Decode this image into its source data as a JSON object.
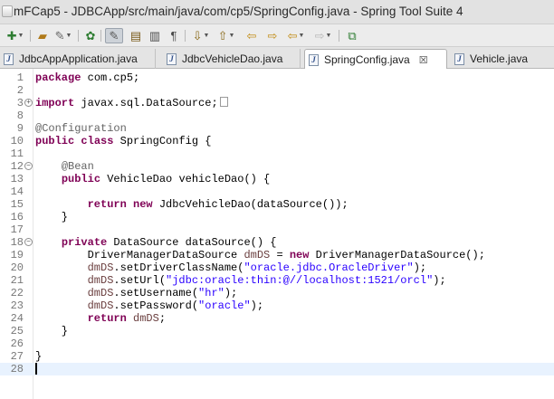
{
  "window": {
    "title": "mFCap5 - JDBCApp/src/main/java/com/cp5/SpringConfig.java - Spring Tool Suite 4"
  },
  "toolbar": {
    "icons": [
      "new-wizard-icon",
      "open-type-icon",
      "build-icon",
      "debug-icon",
      "edit-icon",
      "highlight-icon",
      "open-declaration-icon",
      "toggle-view-icon",
      "show-whitespace-icon",
      "next-annotation-icon",
      "prev-annotation-icon",
      "last-edit-icon",
      "back-icon",
      "forward-icon",
      "open-perspective-icon"
    ]
  },
  "tabs": [
    {
      "label": "JdbcAppApplication.java",
      "active": false
    },
    {
      "label": "JdbcVehicleDao.java",
      "active": false
    },
    {
      "label": "SpringConfig.java",
      "active": true,
      "close": "☒"
    },
    {
      "label": "Vehicle.java",
      "active": false
    }
  ],
  "editor": {
    "lines": [
      {
        "n": "1",
        "fold": "",
        "tokens": [
          {
            "t": "package",
            "c": "kw"
          },
          {
            "t": " com.cp5;",
            "c": ""
          }
        ]
      },
      {
        "n": "2",
        "fold": "",
        "tokens": []
      },
      {
        "n": "3",
        "fold": "+",
        "tokens": [
          {
            "t": "import",
            "c": "kw"
          },
          {
            "t": " javax.sql.DataSource;",
            "c": ""
          }
        ],
        "ellipsis": true
      },
      {
        "n": "8",
        "fold": "",
        "tokens": []
      },
      {
        "n": "9",
        "fold": "",
        "tokens": [
          {
            "t": "@Configuration",
            "c": "an"
          }
        ]
      },
      {
        "n": "10",
        "fold": "",
        "tokens": [
          {
            "t": "public",
            "c": "kw"
          },
          {
            "t": " ",
            "c": ""
          },
          {
            "t": "class",
            "c": "kw"
          },
          {
            "t": " SpringConfig {",
            "c": ""
          }
        ]
      },
      {
        "n": "11",
        "fold": "",
        "tokens": []
      },
      {
        "n": "12",
        "fold": "−",
        "tokens": [
          {
            "t": "    ",
            "c": ""
          },
          {
            "t": "@Bean",
            "c": "an"
          }
        ]
      },
      {
        "n": "13",
        "fold": "",
        "tokens": [
          {
            "t": "    ",
            "c": ""
          },
          {
            "t": "public",
            "c": "kw"
          },
          {
            "t": " VehicleDao vehicleDao() {",
            "c": ""
          }
        ]
      },
      {
        "n": "14",
        "fold": "",
        "tokens": []
      },
      {
        "n": "15",
        "fold": "",
        "tokens": [
          {
            "t": "        ",
            "c": ""
          },
          {
            "t": "return",
            "c": "kw"
          },
          {
            "t": " ",
            "c": ""
          },
          {
            "t": "new",
            "c": "kw"
          },
          {
            "t": " JdbcVehicleDao(dataSource());",
            "c": ""
          }
        ]
      },
      {
        "n": "16",
        "fold": "",
        "tokens": [
          {
            "t": "    }",
            "c": ""
          }
        ]
      },
      {
        "n": "17",
        "fold": "",
        "tokens": []
      },
      {
        "n": "18",
        "fold": "−",
        "tokens": [
          {
            "t": "    ",
            "c": ""
          },
          {
            "t": "private",
            "c": "kw"
          },
          {
            "t": " DataSource dataSource() {",
            "c": ""
          }
        ]
      },
      {
        "n": "19",
        "fold": "",
        "tokens": [
          {
            "t": "        DriverManagerDataSource ",
            "c": ""
          },
          {
            "t": "dmDS",
            "c": "fld"
          },
          {
            "t": " = ",
            "c": ""
          },
          {
            "t": "new",
            "c": "kw"
          },
          {
            "t": " DriverManagerDataSource();",
            "c": ""
          }
        ]
      },
      {
        "n": "20",
        "fold": "",
        "tokens": [
          {
            "t": "        ",
            "c": ""
          },
          {
            "t": "dmDS",
            "c": "fld"
          },
          {
            "t": ".setDriverClassName(",
            "c": ""
          },
          {
            "t": "\"oracle.jdbc.OracleDriver\"",
            "c": "str"
          },
          {
            "t": ");",
            "c": ""
          }
        ]
      },
      {
        "n": "21",
        "fold": "",
        "tokens": [
          {
            "t": "        ",
            "c": ""
          },
          {
            "t": "dmDS",
            "c": "fld"
          },
          {
            "t": ".setUrl(",
            "c": ""
          },
          {
            "t": "\"jdbc:oracle:thin:@//localhost:1521/orcl\"",
            "c": "str"
          },
          {
            "t": ");",
            "c": ""
          }
        ]
      },
      {
        "n": "22",
        "fold": "",
        "tokens": [
          {
            "t": "        ",
            "c": ""
          },
          {
            "t": "dmDS",
            "c": "fld"
          },
          {
            "t": ".setUsername(",
            "c": ""
          },
          {
            "t": "\"hr\"",
            "c": "str"
          },
          {
            "t": ");",
            "c": ""
          }
        ]
      },
      {
        "n": "23",
        "fold": "",
        "tokens": [
          {
            "t": "        ",
            "c": ""
          },
          {
            "t": "dmDS",
            "c": "fld"
          },
          {
            "t": ".setPassword(",
            "c": ""
          },
          {
            "t": "\"oracle\"",
            "c": "str"
          },
          {
            "t": ");",
            "c": ""
          }
        ]
      },
      {
        "n": "24",
        "fold": "",
        "tokens": [
          {
            "t": "        ",
            "c": ""
          },
          {
            "t": "return",
            "c": "kw"
          },
          {
            "t": " ",
            "c": ""
          },
          {
            "t": "dmDS",
            "c": "fld"
          },
          {
            "t": ";",
            "c": ""
          }
        ]
      },
      {
        "n": "25",
        "fold": "",
        "tokens": [
          {
            "t": "    }",
            "c": ""
          }
        ]
      },
      {
        "n": "26",
        "fold": "",
        "tokens": []
      },
      {
        "n": "27",
        "fold": "",
        "tokens": [
          {
            "t": "}",
            "c": ""
          }
        ]
      },
      {
        "n": "28",
        "fold": "",
        "tokens": [],
        "current": true
      }
    ]
  }
}
